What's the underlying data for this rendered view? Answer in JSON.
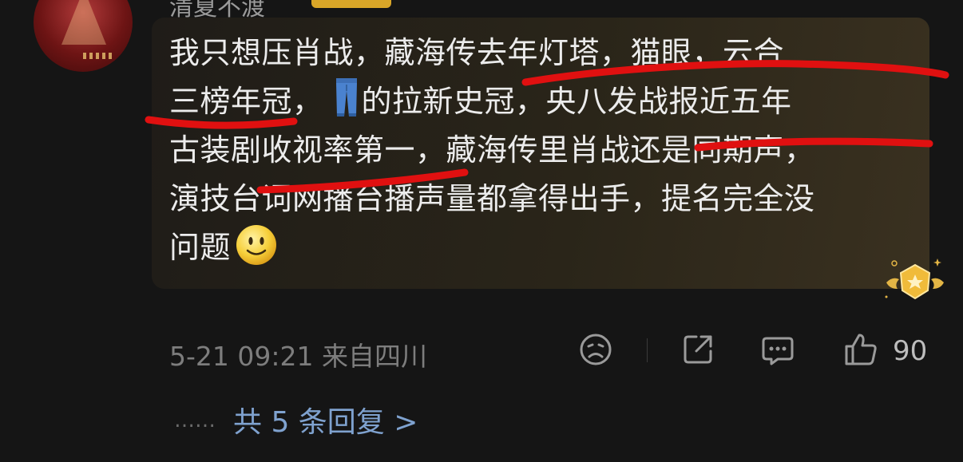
{
  "user": {
    "name": "清夏不渡",
    "badge": "",
    "avatar": "avatar-image"
  },
  "comment": {
    "lines": [
      "我只想压肖战，藏海传去年灯塔，猫眼，云合",
      "三榜年冠，",
      "的拉新史冠，央八发战报近五年",
      "古装剧收视率第一，藏海传里肖战还是同期声，",
      "演技台词网播台播声量都拿得出手，提名完全没",
      "问题"
    ],
    "inline_emoji_1": "jeans-emoji",
    "inline_emoji_2": "smile-emoji"
  },
  "meta": {
    "timestamp": "5-21 09:21 来自四川",
    "like_count": "90"
  },
  "actions": [
    "dislike-icon",
    "share-icon",
    "comment-icon",
    "like-icon"
  ],
  "replies": {
    "dots": "……",
    "label": "共 5 条回复 >"
  },
  "colors": {
    "background": "#151515",
    "bubble": "#2a2519",
    "text": "#ececec",
    "meta": "#7d7d7d",
    "link": "#7fa2cf",
    "annotation": "#e01010"
  }
}
